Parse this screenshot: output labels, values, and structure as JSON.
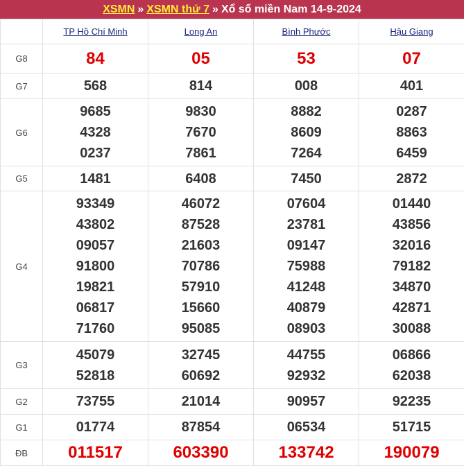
{
  "header": {
    "link1": "XSMN",
    "sep1": "»",
    "link2": "XSMN thứ 7",
    "sep2": "»",
    "title": "Xổ số miền Nam 14-9-2024"
  },
  "provinces": [
    "TP Hồ Chí Minh",
    "Long An",
    "Bình Phước",
    "Hậu Giang"
  ],
  "prizes": {
    "g8": {
      "label": "G8",
      "values": [
        [
          "84"
        ],
        [
          "05"
        ],
        [
          "53"
        ],
        [
          "07"
        ]
      ]
    },
    "g7": {
      "label": "G7",
      "values": [
        [
          "568"
        ],
        [
          "814"
        ],
        [
          "008"
        ],
        [
          "401"
        ]
      ]
    },
    "g6": {
      "label": "G6",
      "values": [
        [
          "9685",
          "4328",
          "0237"
        ],
        [
          "9830",
          "7670",
          "7861"
        ],
        [
          "8882",
          "8609",
          "7264"
        ],
        [
          "0287",
          "8863",
          "6459"
        ]
      ]
    },
    "g5": {
      "label": "G5",
      "values": [
        [
          "1481"
        ],
        [
          "6408"
        ],
        [
          "7450"
        ],
        [
          "2872"
        ]
      ]
    },
    "g4": {
      "label": "G4",
      "values": [
        [
          "93349",
          "43802",
          "09057",
          "91800",
          "19821",
          "06817",
          "71760"
        ],
        [
          "46072",
          "87528",
          "21603",
          "70786",
          "57910",
          "15660",
          "95085"
        ],
        [
          "07604",
          "23781",
          "09147",
          "75988",
          "41248",
          "40879",
          "08903"
        ],
        [
          "01440",
          "43856",
          "32016",
          "79182",
          "34870",
          "42871",
          "30088"
        ]
      ]
    },
    "g3": {
      "label": "G3",
      "values": [
        [
          "45079",
          "52818"
        ],
        [
          "32745",
          "60692"
        ],
        [
          "44755",
          "92932"
        ],
        [
          "06866",
          "62038"
        ]
      ]
    },
    "g2": {
      "label": "G2",
      "values": [
        [
          "73755"
        ],
        [
          "21014"
        ],
        [
          "90957"
        ],
        [
          "92235"
        ]
      ]
    },
    "g1": {
      "label": "G1",
      "values": [
        [
          "01774"
        ],
        [
          "87854"
        ],
        [
          "06534"
        ],
        [
          "51715"
        ]
      ]
    },
    "db": {
      "label": "ĐB",
      "values": [
        [
          "011517"
        ],
        [
          "603390"
        ],
        [
          "133742"
        ],
        [
          "190079"
        ]
      ]
    }
  },
  "colors": {
    "header_bg": "#b8344f",
    "header_link": "#ffeb3b",
    "highlight": "#e00000",
    "province_link": "#1a237e"
  }
}
